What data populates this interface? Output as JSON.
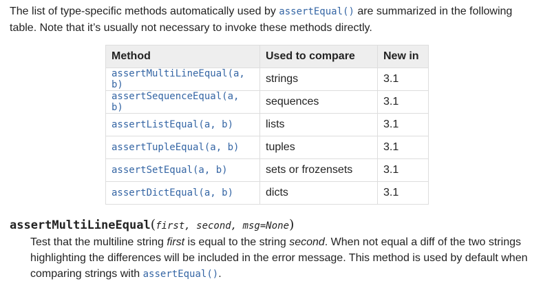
{
  "intro": {
    "before": "The list of type-specific methods automatically used by ",
    "code": "assertEqual()",
    "after": " are summarized in the following table. Note that it’s usually not necessary to invoke these methods directly."
  },
  "table": {
    "headers": [
      "Method",
      "Used to compare",
      "New in"
    ],
    "rows": [
      {
        "method": "assertMultiLineEqual(a, b)",
        "compare": "strings",
        "new_in": "3.1"
      },
      {
        "method": "assertSequenceEqual(a, b)",
        "compare": "sequences",
        "new_in": "3.1"
      },
      {
        "method": "assertListEqual(a, b)",
        "compare": "lists",
        "new_in": "3.1"
      },
      {
        "method": "assertTupleEqual(a, b)",
        "compare": "tuples",
        "new_in": "3.1"
      },
      {
        "method": "assertSetEqual(a, b)",
        "compare": "sets or frozensets",
        "new_in": "3.1"
      },
      {
        "method": "assertDictEqual(a, b)",
        "compare": "dicts",
        "new_in": "3.1"
      }
    ]
  },
  "signature": {
    "name": "assertMultiLineEqual",
    "open": "(",
    "params": [
      "first",
      "second",
      "msg=None"
    ],
    "sep": ", ",
    "close": ")"
  },
  "description": {
    "p1": "Test that the multiline string ",
    "em1": "first",
    "p2": " is equal to the string ",
    "em2": "second",
    "p3": ". When not equal a diff of the two strings highlighting the differences will be included in the error message. This method is used by default when comparing strings with ",
    "code": "assertEqual()",
    "p4": "."
  },
  "colors": {
    "text": "#222222",
    "link": "#3465a4",
    "header_bg": "#eeeeee",
    "border": "#dddddd"
  }
}
